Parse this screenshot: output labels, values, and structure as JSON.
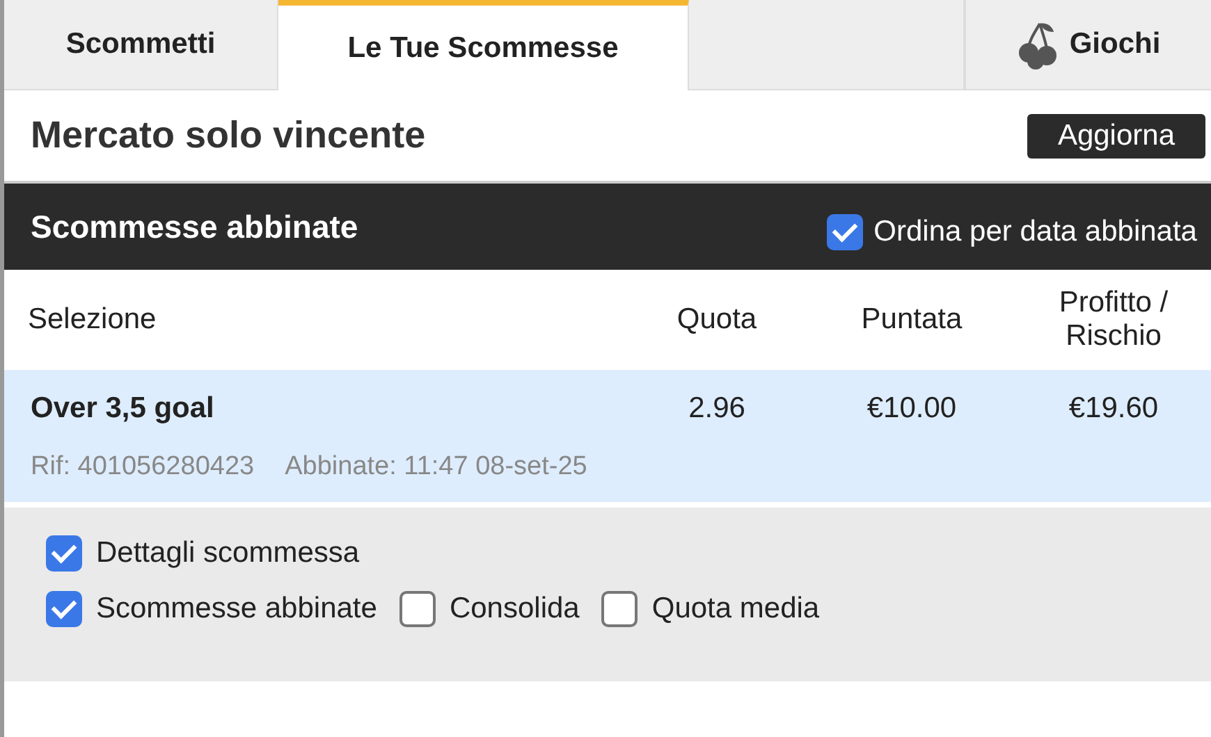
{
  "tabs": [
    {
      "label": "Scommetti",
      "selected": false,
      "kind": "text"
    },
    {
      "label": "Le Tue Scommesse",
      "selected": true,
      "kind": "text"
    },
    {
      "selected": false,
      "kind": "spacer"
    },
    {
      "label": "Giochi",
      "selected": false,
      "kind": "icon"
    }
  ],
  "market": {
    "title": "Mercato solo vincente",
    "button": "Aggiorna"
  },
  "section": {
    "title": "Scommesse abbinate",
    "sort": {
      "label": "Ordina per data abbinata",
      "checked": true
    }
  },
  "table": {
    "columns": [
      "Selezione",
      "Quota",
      "Puntata",
      "Profitto / Rischio"
    ],
    "rows": [
      {
        "selection": "Over 3,5 goal",
        "odds": "2.96",
        "stake": "€10.00",
        "profit": "€19.60",
        "ref": "Rif: 401056280423",
        "matched": "Abbinate: 11:47 08-set-25",
        "selected": true
      }
    ]
  },
  "options": [
    [
      {
        "label": "Dettagli scommessa",
        "checked": true
      }
    ],
    [
      {
        "label": "Scommesse abbinate",
        "checked": true
      },
      {
        "label": "Consolida",
        "checked": false
      },
      {
        "label": "Quota media",
        "checked": false
      }
    ]
  ]
}
